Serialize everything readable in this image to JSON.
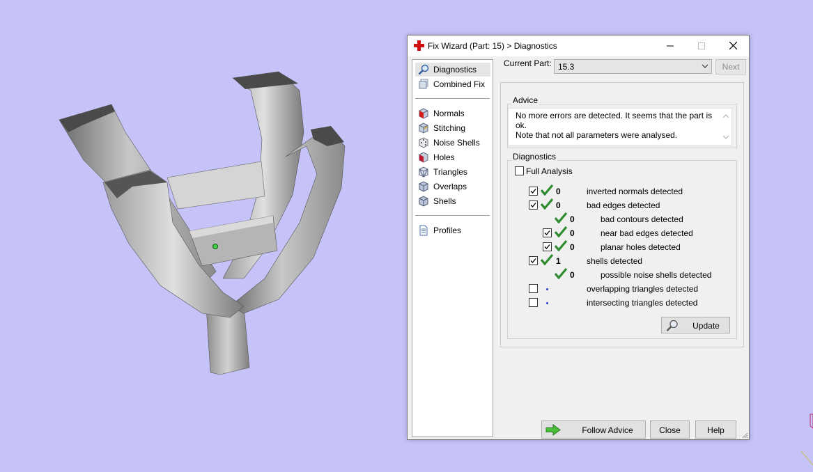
{
  "window": {
    "title": "Fix Wizard (Part: 15) > Diagnostics"
  },
  "nav": {
    "items": [
      {
        "label": "Diagnostics",
        "icon": "magnifier-icon",
        "selected": true
      },
      {
        "label": "Combined Fix",
        "icon": "combined-fix-icon"
      },
      {
        "label": "Normals",
        "icon": "normals-cube-icon"
      },
      {
        "label": "Stitching",
        "icon": "stitching-cube-icon"
      },
      {
        "label": "Noise Shells",
        "icon": "noise-shells-dice-icon"
      },
      {
        "label": "Holes",
        "icon": "holes-cube-icon"
      },
      {
        "label": "Triangles",
        "icon": "triangles-cube-icon"
      },
      {
        "label": "Overlaps",
        "icon": "overlaps-cube-icon"
      },
      {
        "label": "Shells",
        "icon": "shells-cube-icon"
      },
      {
        "label": "Profiles",
        "icon": "profiles-document-icon"
      }
    ]
  },
  "current_part": {
    "label": "Current Part:",
    "value": "15.3",
    "next_label": "Next"
  },
  "advice": {
    "title": "Advice",
    "line1": "No more errors are detected. It seems that the part is ok.",
    "line2": "Note that not all parameters were analysed."
  },
  "diagnostics": {
    "title": "Diagnostics",
    "full_analysis_label": "Full Analysis",
    "full_analysis_checked": false,
    "rows": [
      {
        "checkbox": true,
        "checked": true,
        "status": "ok",
        "count": "0",
        "label": "inverted normals detected",
        "indent": 0
      },
      {
        "checkbox": true,
        "checked": true,
        "status": "ok",
        "count": "0",
        "label": "bad edges detected",
        "indent": 0
      },
      {
        "checkbox": false,
        "checked": false,
        "status": "ok",
        "count": "0",
        "label": "bad contours detected",
        "indent": 1
      },
      {
        "checkbox": true,
        "checked": true,
        "status": "ok",
        "count": "0",
        "label": "near bad edges detected",
        "indent": 1
      },
      {
        "checkbox": true,
        "checked": true,
        "status": "ok",
        "count": "0",
        "label": "planar holes detected",
        "indent": 1
      },
      {
        "checkbox": true,
        "checked": true,
        "status": "ok",
        "count": "1",
        "label": "shells detected",
        "indent": 0
      },
      {
        "checkbox": false,
        "checked": false,
        "status": "ok",
        "count": "0",
        "label": "possible noise shells detected",
        "indent": 1
      },
      {
        "checkbox": true,
        "checked": false,
        "status": "pending",
        "count": "",
        "label": "overlapping triangles detected",
        "indent": 0
      },
      {
        "checkbox": true,
        "checked": false,
        "status": "pending",
        "count": "",
        "label": "intersecting triangles detected",
        "indent": 0
      }
    ],
    "update_label": "Update"
  },
  "footer": {
    "follow_advice_label": "Follow Advice",
    "close_label": "Close",
    "help_label": "Help"
  },
  "colors": {
    "background": "#c6c3f8",
    "check_green": "#2e8b2e",
    "title_icon_red": "#d01010"
  }
}
